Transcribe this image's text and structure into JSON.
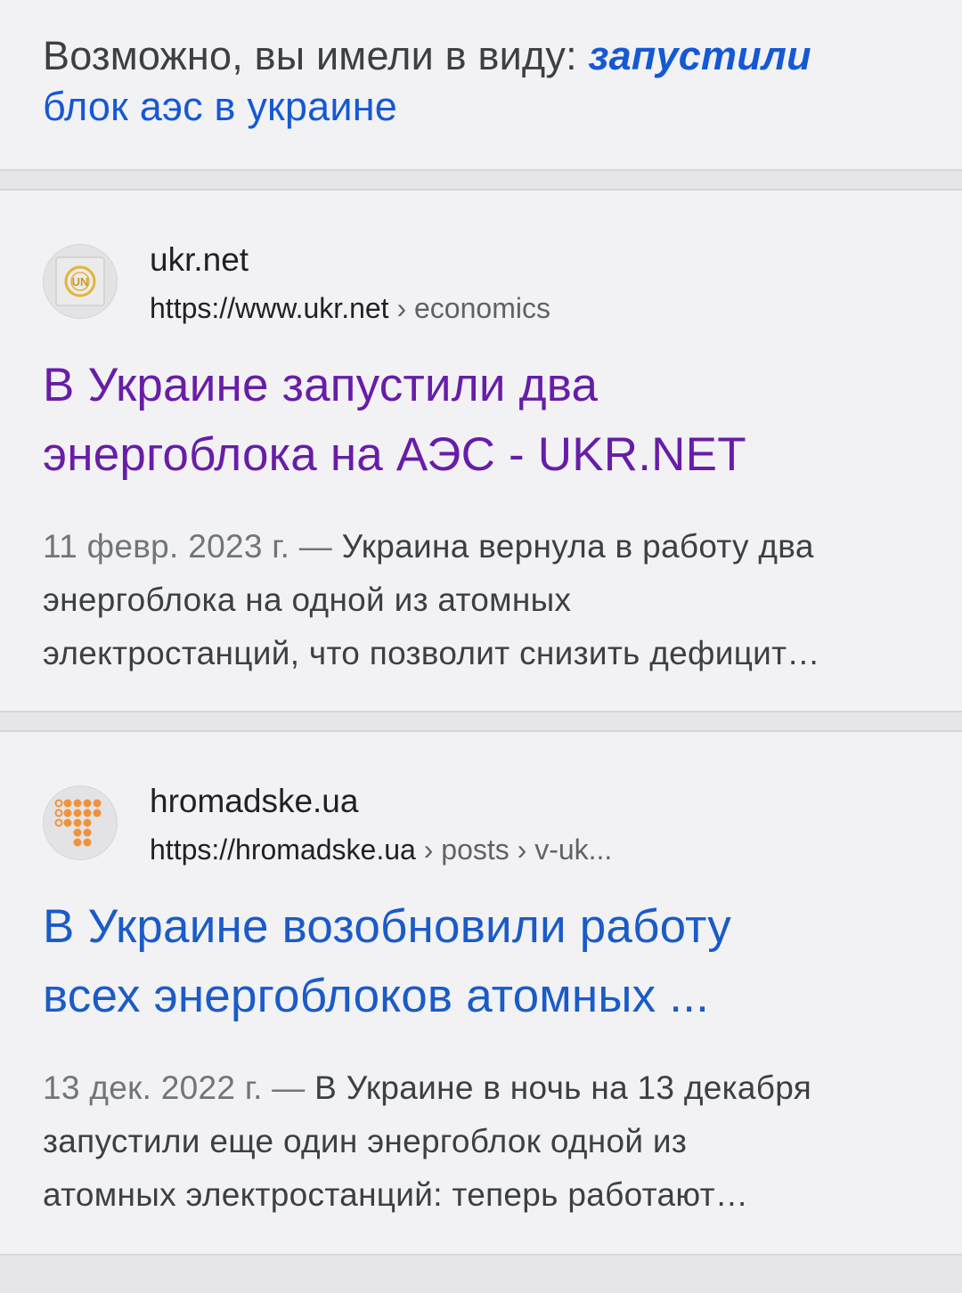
{
  "suggestion": {
    "prefix": "Возможно, вы имели в виду: ",
    "corrected_bold": "запустили",
    "rest": "блок аэс в украине"
  },
  "results": [
    {
      "site_name": "ukr.net",
      "url_base": "https://www.ukr.net",
      "url_path": " › economics",
      "favicon_icon": "ukr-net-logo-icon",
      "title_line1": "В Украине запустили два",
      "title_line2": "энергоблока на АЭС - UKR.NET",
      "date": "11 февр. 2023 г. — ",
      "snippet_line1": "Украина вернула в работу два",
      "snippet_line2": "энергоблока на одной из атомных",
      "snippet_line3": "электростанций, что позволит снизить дефицит…"
    },
    {
      "site_name": "hromadske.ua",
      "url_base": "https://hromadske.ua",
      "url_path": " › posts › v-uk...",
      "favicon_icon": "hromadske-logo-icon",
      "title_line1": "В Украине возобновили работу",
      "title_line2": "всех энергоблоков атомных ...",
      "date": "13 дек. 2022 г. — ",
      "snippet_line1": "В Украине в ночь на 13 декабря",
      "snippet_line2": "запустили еще один энергоблок одной из",
      "snippet_line3": "атомных электростанций: теперь работают…"
    }
  ],
  "colors": {
    "link_blue": "#1a5bc8",
    "visited_purple": "#681da8",
    "background": "#f2f2f4",
    "separator": "#e6e6e8"
  }
}
